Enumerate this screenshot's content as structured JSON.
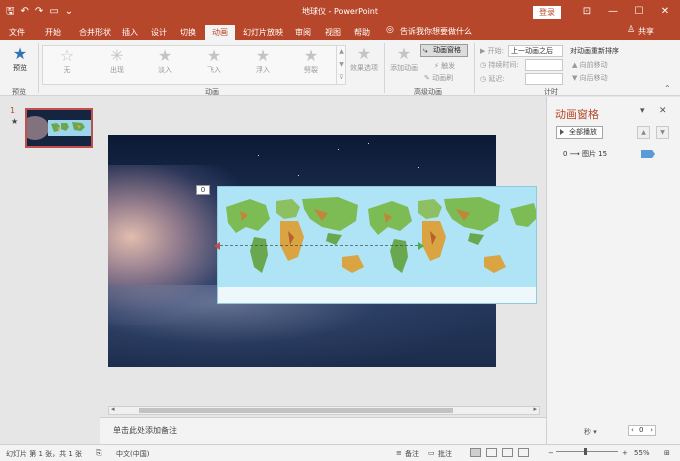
{
  "app": {
    "window_title": "地球仪 - PowerPoint",
    "login_label": "登录",
    "share_label": "共享"
  },
  "qat": {
    "save_icon": "save-icon",
    "undo_icon": "undo-icon",
    "redo_icon": "redo-icon",
    "present_icon": "present-icon"
  },
  "tabs": [
    "文件",
    "开始",
    "合并形状",
    "插入",
    "设计",
    "切换",
    "动画",
    "幻灯片放映",
    "审阅",
    "视图",
    "帮助"
  ],
  "active_tab": "动画",
  "tell_me": "告诉我你想要做什么",
  "ribbon": {
    "preview": {
      "label": "预览",
      "group": "预览"
    },
    "effects": [
      {
        "label": "无"
      },
      {
        "label": "出现"
      },
      {
        "label": "淡入"
      },
      {
        "label": "飞入"
      },
      {
        "label": "浮入"
      },
      {
        "label": "劈裂"
      }
    ],
    "effect_options": "效果选项",
    "animation_group": "动画",
    "add_animation": "添加动画",
    "animation_pane": "动画窗格",
    "trigger": "触发",
    "painter": "动画刷",
    "advanced_group": "高级动画",
    "start_label": "开始:",
    "start_value": "上一动画之后",
    "duration_label": "持续时间:",
    "delay_label": "延迟:",
    "reorder_label": "对动画重新排序",
    "move_earlier": "向前移动",
    "move_later": "向后移动",
    "timing_group": "计时"
  },
  "thumbnails": [
    {
      "number": "1",
      "marker": "★"
    }
  ],
  "slide": {
    "anim_tag": "0"
  },
  "notes_placeholder": "单击此处添加备注",
  "animation_pane": {
    "title": "动画窗格",
    "play_all": "全部播放",
    "items": [
      {
        "label": "0 ⟶ 图片 15"
      }
    ],
    "seconds_label": "秒 ▾",
    "seconds_value": "0"
  },
  "status": {
    "slide_info": "幻灯片 第 1 张，共 1 张",
    "language": "中文(中国)",
    "notes": "备注",
    "comments": "批注",
    "zoom": "55%"
  },
  "colors": {
    "accent": "#b7472a",
    "pane_bar": "#5b9bd5"
  }
}
